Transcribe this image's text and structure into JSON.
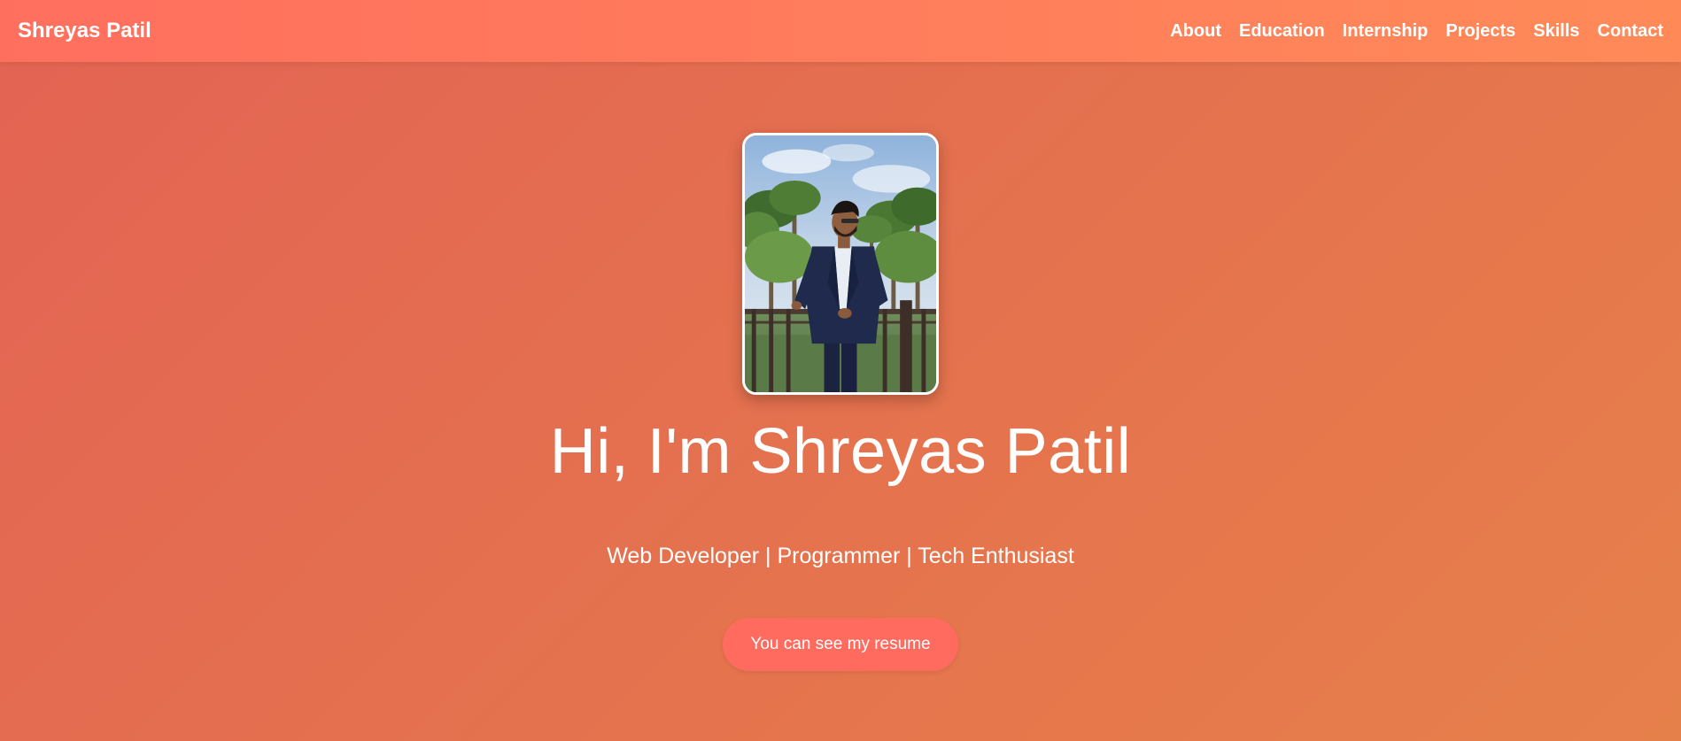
{
  "navbar": {
    "brand": "Shreyas Patil",
    "links": [
      {
        "label": "About"
      },
      {
        "label": "Education"
      },
      {
        "label": "Internship"
      },
      {
        "label": "Projects"
      },
      {
        "label": "Skills"
      },
      {
        "label": "Contact"
      }
    ]
  },
  "hero": {
    "title": "Hi, I'm Shreyas Patil",
    "subtitle": "Web Developer | Programmer | Tech Enthusiast",
    "cta_label": "You can see my resume"
  },
  "colors": {
    "navbar_gradient_start": "#ff6f5e",
    "navbar_gradient_end": "#ff8a58",
    "page_gradient_start": "#e36353",
    "page_gradient_end": "#e6804b",
    "button_bg": "#ff6b5e",
    "text": "#ffffff"
  }
}
